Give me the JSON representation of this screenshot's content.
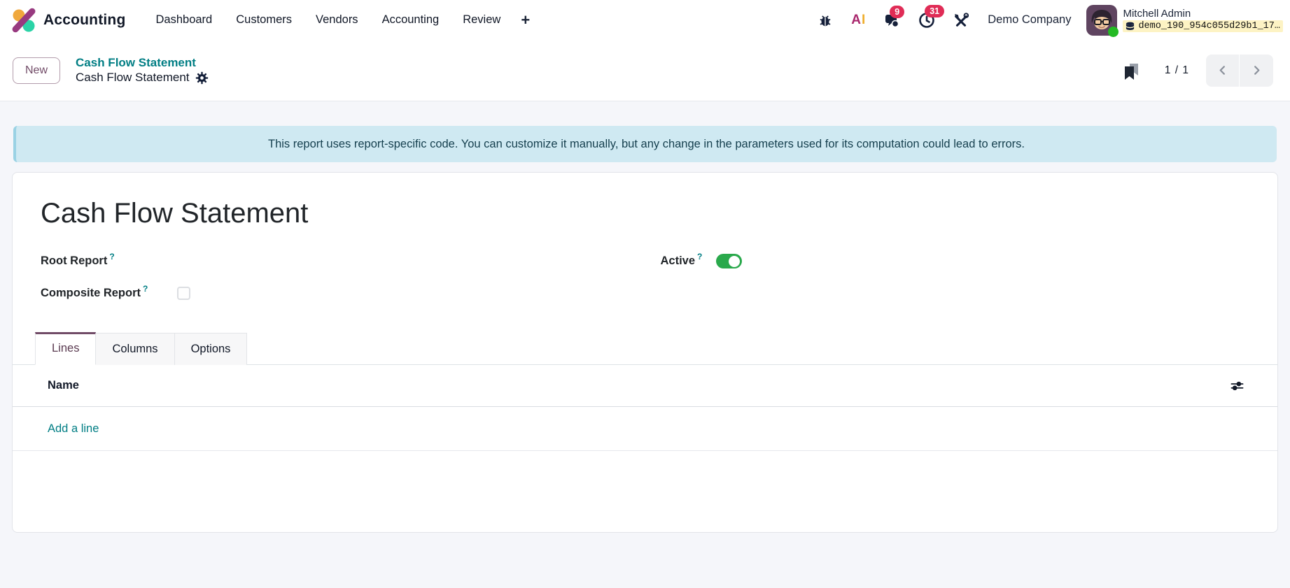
{
  "topbar": {
    "brand": "Accounting",
    "menu": [
      "Dashboard",
      "Customers",
      "Vendors",
      "Accounting",
      "Review"
    ],
    "plus_label": "+",
    "systray": {
      "ai_a": "A",
      "ai_i": "I",
      "messages_badge": "9",
      "activities_badge": "31",
      "company": "Demo Company",
      "user_name": "Mitchell Admin",
      "database": "demo_190_954c055d29b1_17…"
    }
  },
  "control_panel": {
    "new_button": "New",
    "breadcrumb_parent": "Cash Flow Statement",
    "breadcrumb_current": "Cash Flow Statement",
    "pager_value": "1 / 1"
  },
  "banner": {
    "text": "This report uses report-specific code. You can customize it manually, but any change in the parameters used for its computation could lead to errors."
  },
  "form": {
    "title": "Cash Flow Statement",
    "root_report_label": "Root Report",
    "active_label": "Active",
    "active_value": "on",
    "composite_label": "Composite Report",
    "composite_value": "unchecked",
    "help_marker": "?",
    "tabs": [
      {
        "label": "Lines",
        "active": true
      },
      {
        "label": "Columns",
        "active": false
      },
      {
        "label": "Options",
        "active": false
      }
    ],
    "table": {
      "name_header": "Name",
      "add_line": "Add a line"
    }
  },
  "icons": {
    "accounting_logo": "percent-mark: orange dot, purple slash, teal dot",
    "bug_icon": "bug glyph",
    "ai_icon": "AI two-tone letters",
    "messages_icon": "chat bubbles",
    "activities_icon": "clock",
    "tools_icon": "crossed wrench and screwdriver",
    "gear_icon": "cogwheel",
    "bookmark_icon": "double bookmark",
    "chevron_left_icon": "<",
    "chevron_right_icon": ">",
    "optional_columns_icon": "two slider lines",
    "db_icon": "database cylinder"
  },
  "colors": {
    "brand_purple": "#714B67",
    "teal": "#017e84",
    "badge_red": "#e02c56",
    "toggle_green": "#2aa94c",
    "banner_bg": "#cfe9f2",
    "page_bg": "#f5f6fa"
  }
}
